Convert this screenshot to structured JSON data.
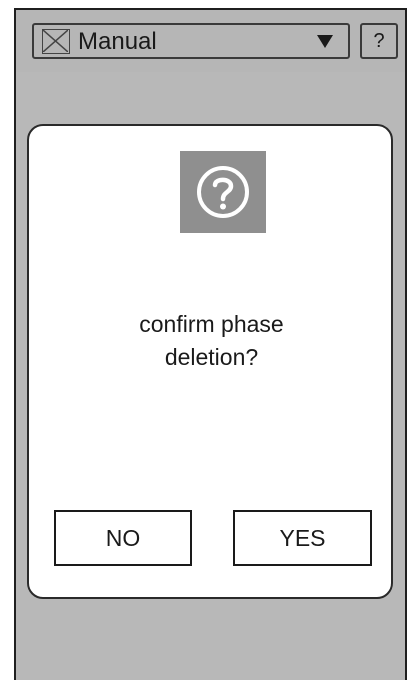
{
  "header": {
    "mode_icon": "image-placeholder-icon",
    "mode_label": "Manual",
    "dropdown_icon": "chevron-down-icon",
    "help_label": "?"
  },
  "dialog": {
    "icon": "question-icon",
    "message_line_1": "confirm phase",
    "message_line_2": "deletion?",
    "no_label": "NO",
    "yes_label": "YES"
  },
  "colors": {
    "background": "#b8b8b8",
    "dialog_background": "#ffffff",
    "icon_background": "#8f8f8f",
    "border": "#1a1a1a"
  }
}
